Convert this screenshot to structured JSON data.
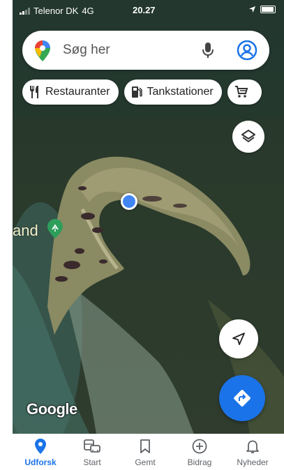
{
  "status_bar": {
    "carrier": "Telenor DK",
    "network": "4G",
    "time": "20.27"
  },
  "search": {
    "placeholder": "Søg her",
    "icons": [
      "maps-pin-icon",
      "microphone-icon",
      "account-icon"
    ]
  },
  "chips": [
    {
      "label": "Restauranter",
      "icon": "fork-knife-icon"
    },
    {
      "label": "Tankstationer",
      "icon": "gas-pump-icon"
    },
    {
      "label": "",
      "icon": "shopping-cart-icon"
    }
  ],
  "map": {
    "place_label": "and",
    "attribution": "Google"
  },
  "fab": {
    "layers_icon": "layers-icon",
    "locate_icon": "navigation-arrow-icon",
    "directions_icon": "directions-icon",
    "directions_color": "#1a73e8"
  },
  "bottom_nav": {
    "active_color": "#1a73e8",
    "items": [
      {
        "label": "Udforsk",
        "icon": "location-pin-icon",
        "active": true
      },
      {
        "label": "Start",
        "icon": "commute-icon",
        "active": false
      },
      {
        "label": "Gemt",
        "icon": "bookmark-icon",
        "active": false
      },
      {
        "label": "Bidrag",
        "icon": "add-circle-icon",
        "active": false
      },
      {
        "label": "Nyheder",
        "icon": "bell-icon",
        "active": false
      }
    ]
  }
}
